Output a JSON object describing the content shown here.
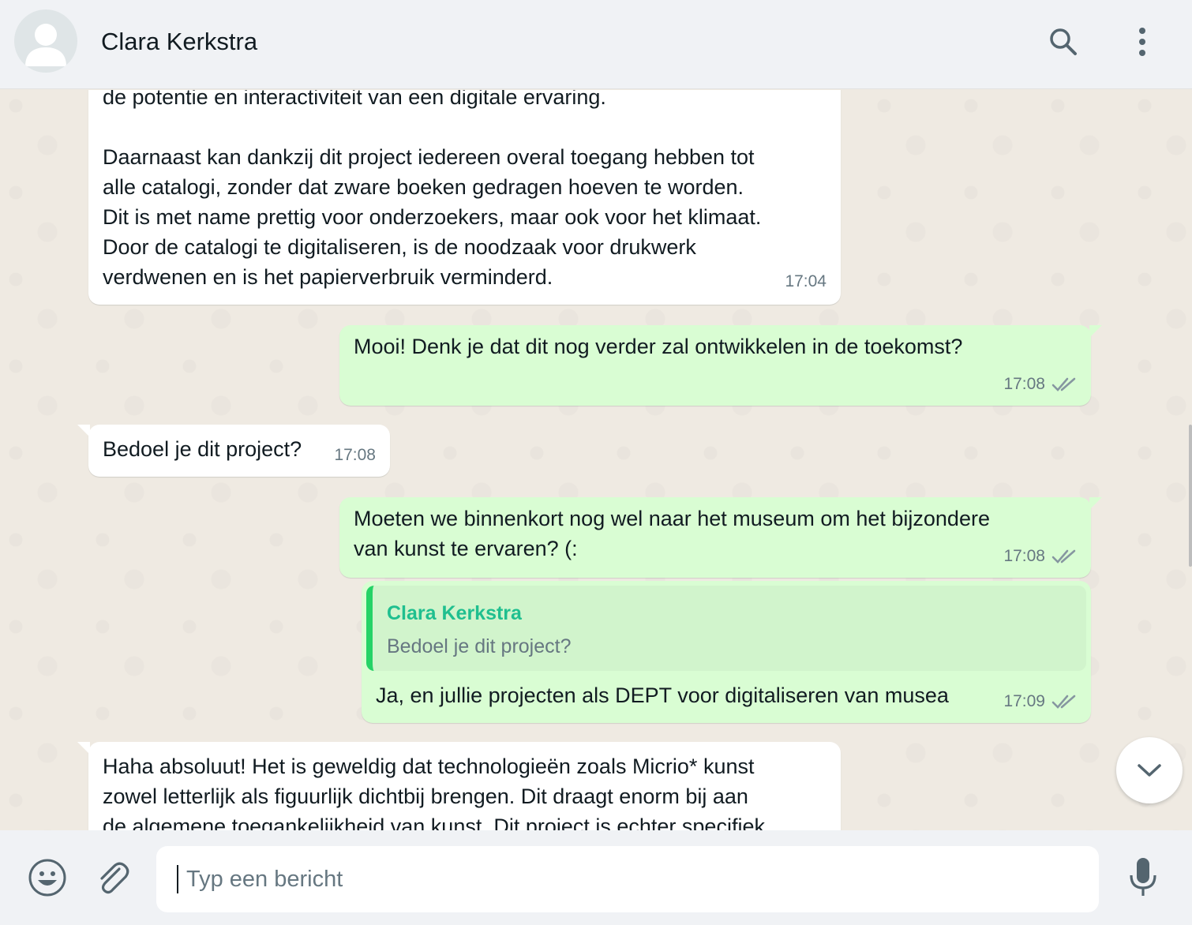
{
  "header": {
    "contact_name": "Clara Kerkstra",
    "icons": {
      "avatar": "default-avatar",
      "search": "search-icon",
      "menu": "more-vertical-icon"
    }
  },
  "messages": [
    {
      "direction": "incoming",
      "text": "de potentie en interactiviteit van een digitale ervaring.\n\nDaarnaast kan dankzij dit project iedereen overal toegang hebben tot\nalle catalogi, zonder dat zware boeken gedragen hoeven te worden.\nDit is met name prettig voor onderzoekers, maar ook voor het klimaat.\nDoor de catalogi te digitaliseren, is de noodzaak voor drukwerk\nverdwenen en is het papierverbruik verminderd.",
      "time": "17:04"
    },
    {
      "direction": "outgoing",
      "text": "Mooi! Denk je dat dit nog verder zal ontwikkelen in de toekomst?",
      "time": "17:08",
      "status": "read"
    },
    {
      "direction": "incoming",
      "text": "Bedoel je dit project?",
      "time": "17:08"
    },
    {
      "direction": "outgoing",
      "text": "Moeten we binnenkort nog wel naar het museum om het bijzondere\nvan kunst te ervaren? (:",
      "time": "17:08",
      "status": "read"
    },
    {
      "direction": "outgoing",
      "quote": {
        "author": "Clara Kerkstra",
        "text": "Bedoel je dit project?"
      },
      "text": "Ja, en jullie projecten als DEPT voor digitaliseren van musea",
      "time": "17:09",
      "status": "read"
    },
    {
      "direction": "incoming",
      "text": "Haha absoluut! Het is geweldig dat technologieën zoals Micrio* kunst\nzowel letterlijk als figuurlijk dichtbij brengen. Dit draagt enorm bij aan\nde algemene toegankelijkheid van kunst. Dit project is echter specifiek"
    }
  ],
  "composer": {
    "placeholder": "Typ een bericht",
    "icons": {
      "emoji": "emoji-icon",
      "attach": "paperclip-icon",
      "mic": "microphone-icon"
    }
  },
  "scroll_down_icon": "chevron-down-icon",
  "colors": {
    "incoming_bubble": "#ffffff",
    "outgoing_bubble": "#d9fdd3",
    "quote_bar": "#25d366",
    "quote_author": "#1fbf8f",
    "chat_background": "#efeae2",
    "header_background": "#f0f2f5"
  }
}
